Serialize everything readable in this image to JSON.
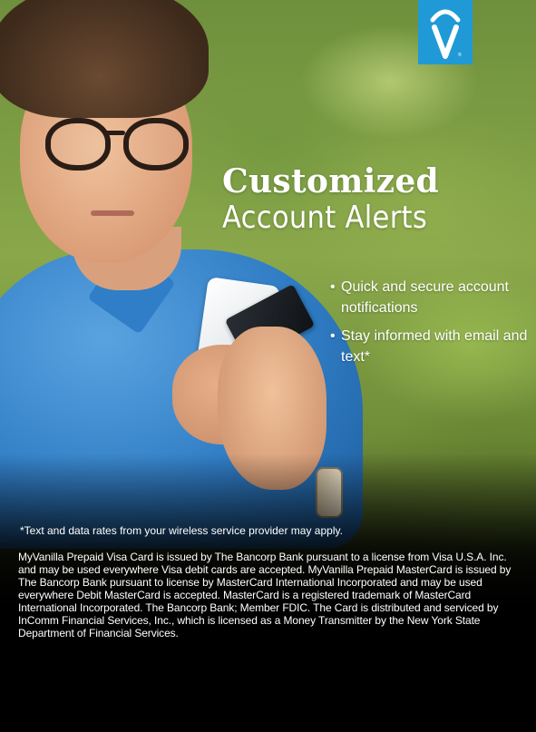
{
  "brand": {
    "logo_icon": "vanilla-v-icon",
    "logo_color": "#1f9ad6"
  },
  "headline": {
    "line1": "Customized",
    "line2": "Account Alerts"
  },
  "bullets": [
    {
      "symbol": "•",
      "text": "Quick and secure account notifications"
    },
    {
      "symbol": "•",
      "text": "Stay informed with email and text*"
    }
  ],
  "footnote": "*Text and data rates from your wireless service provider may apply.",
  "legal": "MyVanilla Prepaid Visa Card is issued by The Bancorp Bank pursuant to a license from Visa U.S.A. Inc. and may be used everywhere Visa debit cards are accepted. MyVanilla Prepaid MasterCard is issued by The Bancorp Bank pursuant to license by MasterCard International Incorporated and may be used everywhere Debit MasterCard is accepted. MasterCard is a registered trademark of MasterCard International Incorporated. The Bancorp Bank; Member FDIC. The Card is distributed and serviced by InComm Financial Services, Inc., which is licensed as a Money Transmitter by the New York State Department of Financial Services.",
  "colors": {
    "background": "#000000",
    "text": "#ffffff",
    "foliage": "#8aa84a",
    "shirt": "#2f7cc4"
  }
}
